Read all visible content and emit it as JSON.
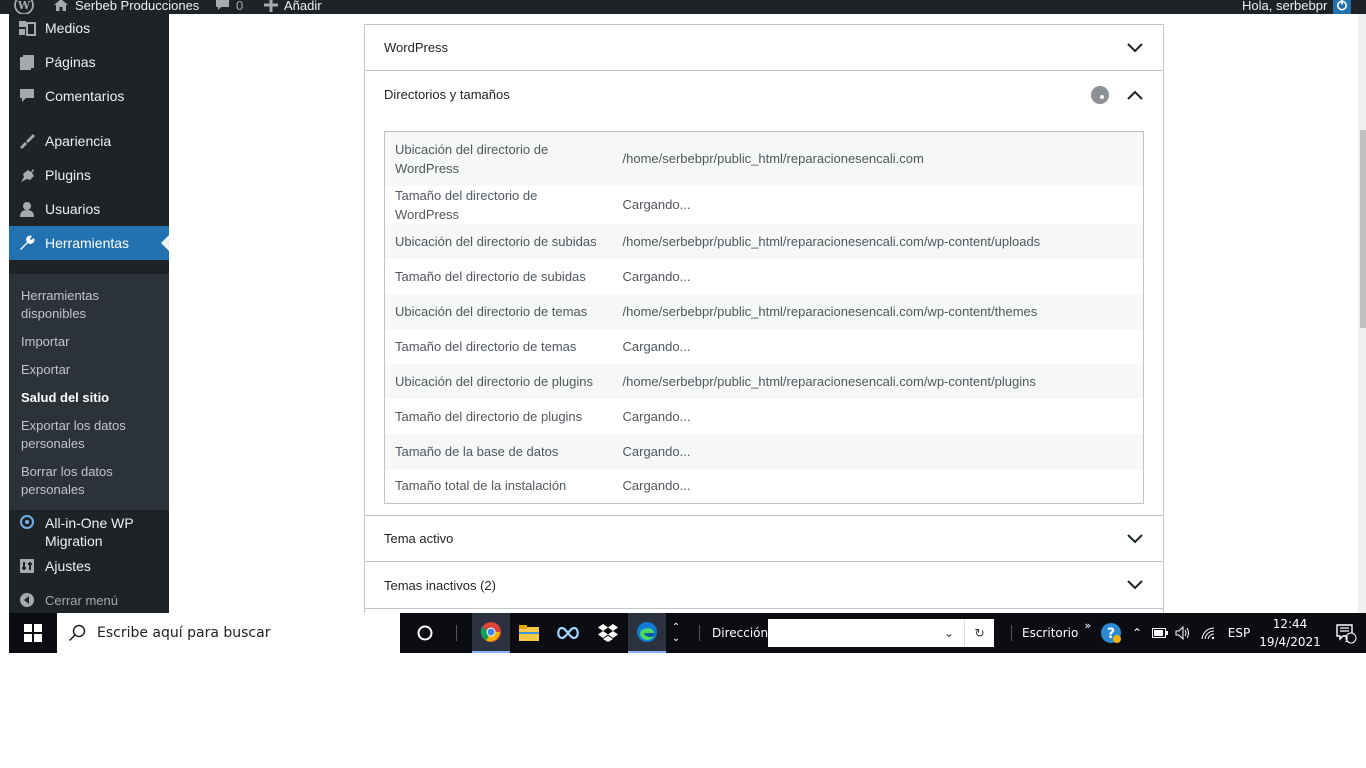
{
  "adminbar": {
    "site_name": "Serbeb Producciones",
    "comments_count": "0",
    "add_new": "Añadir",
    "greeting": "Hola, serbebpr"
  },
  "sidebar": {
    "items": [
      {
        "label": "Medios",
        "icon": "media-icon"
      },
      {
        "label": "Páginas",
        "icon": "pages-icon"
      },
      {
        "label": "Comentarios",
        "icon": "comments-icon"
      },
      {
        "label": "Apariencia",
        "icon": "appearance-icon"
      },
      {
        "label": "Plugins",
        "icon": "plugins-icon"
      },
      {
        "label": "Usuarios",
        "icon": "users-icon"
      },
      {
        "label": "Herramientas",
        "icon": "tools-icon"
      },
      {
        "label": "All-in-One WP Migration",
        "icon": "migration-icon"
      },
      {
        "label": "Ajustes",
        "icon": "settings-icon"
      }
    ],
    "submenu": [
      "Herramientas disponibles",
      "Importar",
      "Exportar",
      "Salud del sitio",
      "Exportar los datos personales",
      "Borrar los datos personales"
    ],
    "collapse": "Cerrar menú"
  },
  "panels": {
    "wordpress": "WordPress",
    "directories": "Directorios y tamaños",
    "active_theme": "Tema activo",
    "inactive_themes": "Temas inactivos (2)"
  },
  "table": [
    {
      "label": "Ubicación del directorio de WordPress",
      "value": "/home/serbebpr/public_html/reparacionesencali.com"
    },
    {
      "label": "Tamaño del directorio de WordPress",
      "value": "Cargando..."
    },
    {
      "label": "Ubicación del directorio de subidas",
      "value": "/home/serbebpr/public_html/reparacionesencali.com/wp-content/uploads"
    },
    {
      "label": "Tamaño del directorio de subidas",
      "value": "Cargando..."
    },
    {
      "label": "Ubicación del directorio de temas",
      "value": "/home/serbebpr/public_html/reparacionesencali.com/wp-content/themes"
    },
    {
      "label": "Tamaño del directorio de temas",
      "value": "Cargando..."
    },
    {
      "label": "Ubicación del directorio de plugins",
      "value": "/home/serbebpr/public_html/reparacionesencali.com/wp-content/plugins"
    },
    {
      "label": "Tamaño del directorio de plugins",
      "value": "Cargando..."
    },
    {
      "label": "Tamaño de la base de datos",
      "value": "Cargando..."
    },
    {
      "label": "Tamaño total de la instalación",
      "value": "Cargando..."
    }
  ],
  "taskbar": {
    "search_placeholder": "Escribe aquí para buscar",
    "address_label": "Dirección",
    "desktop_label": "Escritorio",
    "language": "ESP",
    "time": "12:44",
    "date": "19/4/2021",
    "notification_count": "1",
    "apps": [
      "cortana-icon",
      "chrome-icon",
      "file-explorer-icon",
      "infinity-app-icon",
      "dropbox-icon",
      "edge-icon"
    ]
  },
  "colors": {
    "admin_dark": "#1d2327",
    "accent": "#2271b1",
    "taskbar": "#0b0d13"
  }
}
